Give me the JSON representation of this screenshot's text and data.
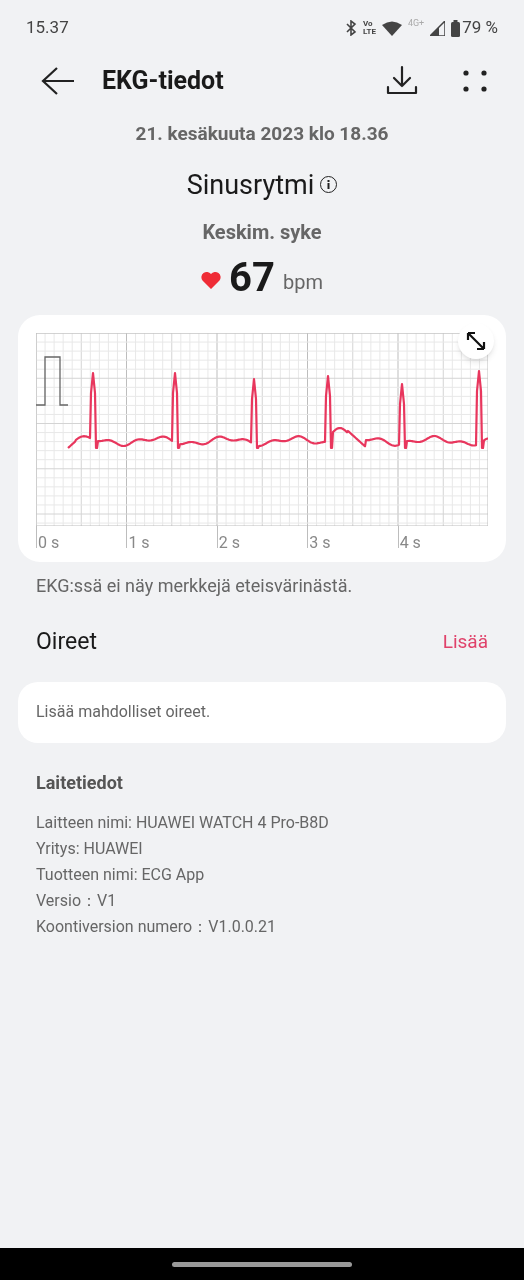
{
  "status_bar": {
    "time": "15.37",
    "volte_top": "Vo",
    "volte_bottom": "LTE",
    "network": "4G+",
    "battery": "79 %"
  },
  "header": {
    "title": "EKG-tiedot"
  },
  "summary": {
    "date": "21. kesäkuuta 2023 klo 18.36",
    "rhythm": "Sinusrytmi",
    "avg_label": "Keskim. syke",
    "bpm": "67",
    "unit": "bpm"
  },
  "ecg": {
    "x_labels": [
      "0 s",
      "1 s",
      "2 s",
      "3 s",
      "4 s"
    ],
    "caption": "EKG:ssä ei näy merkkejä eteisvärinästä."
  },
  "symptoms": {
    "title": "Oireet",
    "add": "Lisää",
    "placeholder": "Lisää mahdolliset oireet."
  },
  "device_info": {
    "title": "Laitetiedot",
    "lines": [
      "Laitteen nimi: HUAWEI WATCH 4 Pro-B8D",
      "Yritys: HUAWEI",
      "Tuotteen nimi: ECG App",
      "Versio：V1",
      "Koontiversion numero：V1.0.0.21"
    ]
  }
}
